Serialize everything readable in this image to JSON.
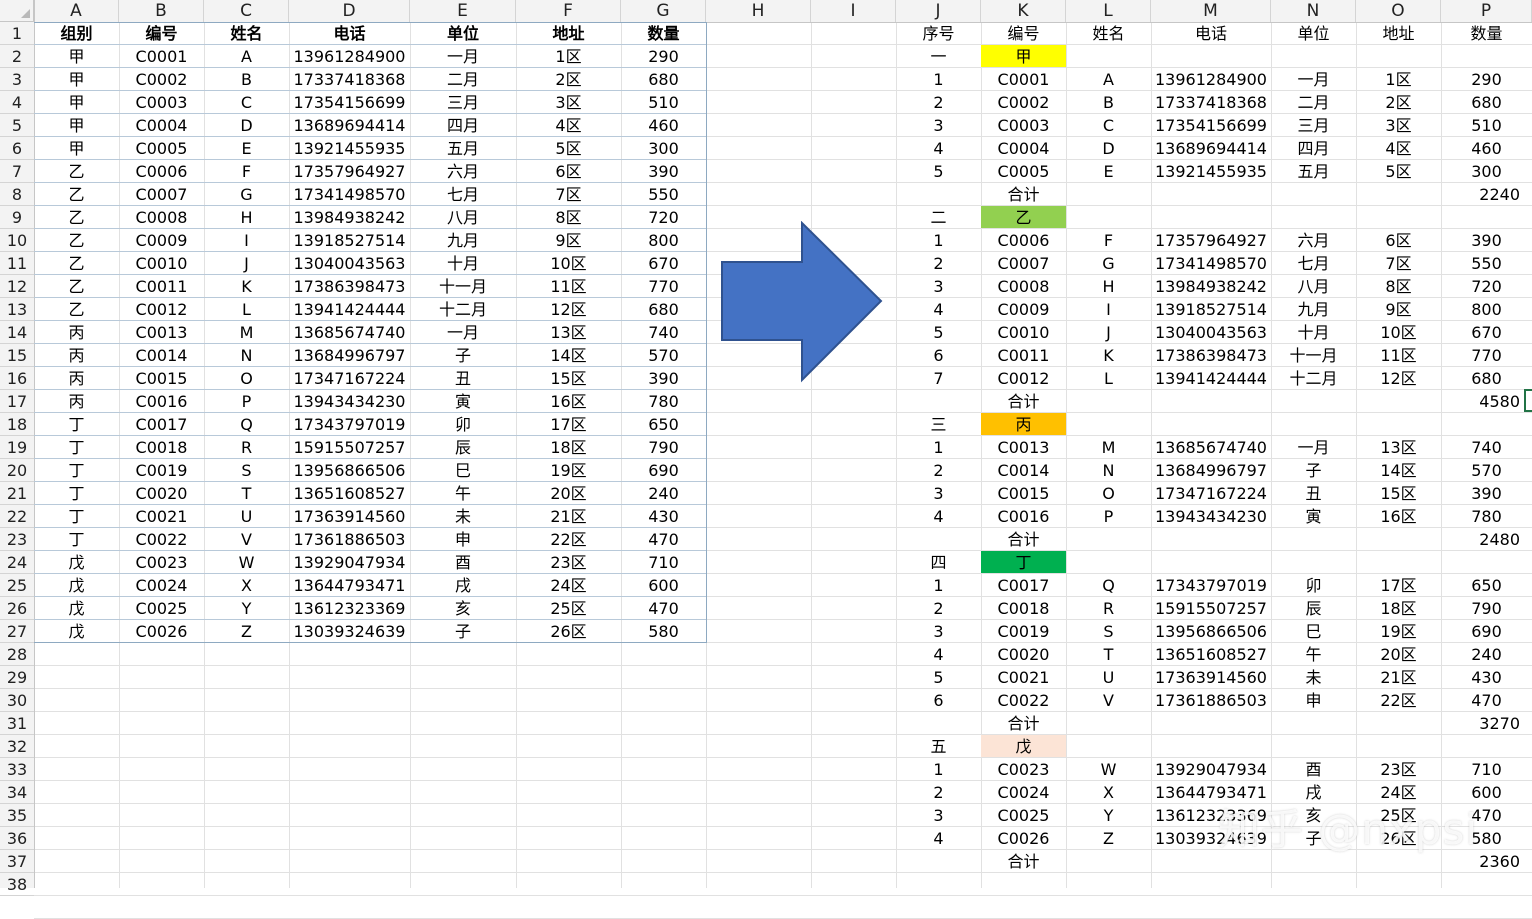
{
  "columns": [
    "A",
    "B",
    "C",
    "D",
    "E",
    "F",
    "G",
    "H",
    "I",
    "J",
    "K",
    "L",
    "M",
    "N",
    "O",
    "P"
  ],
  "rows": [
    "1",
    "2",
    "3",
    "4",
    "5",
    "6",
    "7",
    "8",
    "9",
    "10",
    "11",
    "12",
    "13",
    "14",
    "15",
    "16",
    "17",
    "18",
    "19",
    "20",
    "21",
    "22",
    "23",
    "24",
    "25",
    "26",
    "27",
    "28",
    "29",
    "30",
    "31",
    "32",
    "33",
    "34",
    "35",
    "36",
    "37",
    "38"
  ],
  "colors": {
    "group1": "#ffff00",
    "group2": "#92d050",
    "group3": "#ffc000",
    "group4": "#00b050",
    "group5": "#fce4d6",
    "arrow": "#4472c4",
    "grid": "#e1e1e1"
  },
  "source": {
    "headers": [
      "组别",
      "编号",
      "姓名",
      "电话",
      "单位",
      "地址",
      "数量"
    ],
    "rows": [
      [
        "甲",
        "C0001",
        "A",
        "13961284900",
        "一月",
        "1区",
        "290"
      ],
      [
        "甲",
        "C0002",
        "B",
        "17337418368",
        "二月",
        "2区",
        "680"
      ],
      [
        "甲",
        "C0003",
        "C",
        "17354156699",
        "三月",
        "3区",
        "510"
      ],
      [
        "甲",
        "C0004",
        "D",
        "13689694414",
        "四月",
        "4区",
        "460"
      ],
      [
        "甲",
        "C0005",
        "E",
        "13921455935",
        "五月",
        "5区",
        "300"
      ],
      [
        "乙",
        "C0006",
        "F",
        "17357964927",
        "六月",
        "6区",
        "390"
      ],
      [
        "乙",
        "C0007",
        "G",
        "17341498570",
        "七月",
        "7区",
        "550"
      ],
      [
        "乙",
        "C0008",
        "H",
        "13984938242",
        "八月",
        "8区",
        "720"
      ],
      [
        "乙",
        "C0009",
        "I",
        "13918527514",
        "九月",
        "9区",
        "800"
      ],
      [
        "乙",
        "C0010",
        "J",
        "13040043563",
        "十月",
        "10区",
        "670"
      ],
      [
        "乙",
        "C0011",
        "K",
        "17386398473",
        "十一月",
        "11区",
        "770"
      ],
      [
        "乙",
        "C0012",
        "L",
        "13941424444",
        "十二月",
        "12区",
        "680"
      ],
      [
        "丙",
        "C0013",
        "M",
        "13685674740",
        "一月",
        "13区",
        "740"
      ],
      [
        "丙",
        "C0014",
        "N",
        "13684996797",
        "子",
        "14区",
        "570"
      ],
      [
        "丙",
        "C0015",
        "O",
        "17347167224",
        "丑",
        "15区",
        "390"
      ],
      [
        "丙",
        "C0016",
        "P",
        "13943434230",
        "寅",
        "16区",
        "780"
      ],
      [
        "丁",
        "C0017",
        "Q",
        "17343797019",
        "卯",
        "17区",
        "650"
      ],
      [
        "丁",
        "C0018",
        "R",
        "15915507257",
        "辰",
        "18区",
        "790"
      ],
      [
        "丁",
        "C0019",
        "S",
        "13956866506",
        "巳",
        "19区",
        "690"
      ],
      [
        "丁",
        "C0020",
        "T",
        "13651608527",
        "午",
        "20区",
        "240"
      ],
      [
        "丁",
        "C0021",
        "U",
        "17363914560",
        "未",
        "21区",
        "430"
      ],
      [
        "丁",
        "C0022",
        "V",
        "17361886503",
        "申",
        "22区",
        "470"
      ],
      [
        "戊",
        "C0023",
        "W",
        "13929047934",
        "酉",
        "23区",
        "710"
      ],
      [
        "戊",
        "C0024",
        "X",
        "13644793471",
        "戌",
        "24区",
        "600"
      ],
      [
        "戊",
        "C0025",
        "Y",
        "13612323369",
        "亥",
        "25区",
        "470"
      ],
      [
        "戊",
        "C0026",
        "Z",
        "13039324639",
        "子",
        "26区",
        "580"
      ]
    ]
  },
  "result": {
    "headers": [
      "序号",
      "编号",
      "姓名",
      "电话",
      "单位",
      "地址",
      "数量"
    ],
    "total_label": "合计",
    "groups": [
      {
        "index": "一",
        "name": "甲",
        "color_key": "group1",
        "total": "2240",
        "items": [
          [
            "1",
            "C0001",
            "A",
            "13961284900",
            "一月",
            "1区",
            "290"
          ],
          [
            "2",
            "C0002",
            "B",
            "17337418368",
            "二月",
            "2区",
            "680"
          ],
          [
            "3",
            "C0003",
            "C",
            "17354156699",
            "三月",
            "3区",
            "510"
          ],
          [
            "4",
            "C0004",
            "D",
            "13689694414",
            "四月",
            "4区",
            "460"
          ],
          [
            "5",
            "C0005",
            "E",
            "13921455935",
            "五月",
            "5区",
            "300"
          ]
        ]
      },
      {
        "index": "二",
        "name": "乙",
        "color_key": "group2",
        "total": "4580",
        "items": [
          [
            "1",
            "C0006",
            "F",
            "17357964927",
            "六月",
            "6区",
            "390"
          ],
          [
            "2",
            "C0007",
            "G",
            "17341498570",
            "七月",
            "7区",
            "550"
          ],
          [
            "3",
            "C0008",
            "H",
            "13984938242",
            "八月",
            "8区",
            "720"
          ],
          [
            "4",
            "C0009",
            "I",
            "13918527514",
            "九月",
            "9区",
            "800"
          ],
          [
            "5",
            "C0010",
            "J",
            "13040043563",
            "十月",
            "10区",
            "670"
          ],
          [
            "6",
            "C0011",
            "K",
            "17386398473",
            "十一月",
            "11区",
            "770"
          ],
          [
            "7",
            "C0012",
            "L",
            "13941424444",
            "十二月",
            "12区",
            "680"
          ]
        ]
      },
      {
        "index": "三",
        "name": "丙",
        "color_key": "group3",
        "total": "2480",
        "items": [
          [
            "1",
            "C0013",
            "M",
            "13685674740",
            "一月",
            "13区",
            "740"
          ],
          [
            "2",
            "C0014",
            "N",
            "13684996797",
            "子",
            "14区",
            "570"
          ],
          [
            "3",
            "C0015",
            "O",
            "17347167224",
            "丑",
            "15区",
            "390"
          ],
          [
            "4",
            "C0016",
            "P",
            "13943434230",
            "寅",
            "16区",
            "780"
          ]
        ]
      },
      {
        "index": "四",
        "name": "丁",
        "color_key": "group4",
        "total": "3270",
        "items": [
          [
            "1",
            "C0017",
            "Q",
            "17343797019",
            "卯",
            "17区",
            "650"
          ],
          [
            "2",
            "C0018",
            "R",
            "15915507257",
            "辰",
            "18区",
            "790"
          ],
          [
            "3",
            "C0019",
            "S",
            "13956866506",
            "巳",
            "19区",
            "690"
          ],
          [
            "4",
            "C0020",
            "T",
            "13651608527",
            "午",
            "20区",
            "240"
          ],
          [
            "5",
            "C0021",
            "U",
            "17363914560",
            "未",
            "21区",
            "430"
          ],
          [
            "6",
            "C0022",
            "V",
            "17361886503",
            "申",
            "22区",
            "470"
          ]
        ]
      },
      {
        "index": "五",
        "name": "戊",
        "color_key": "group5",
        "total": "2360",
        "items": [
          [
            "1",
            "C0023",
            "W",
            "13929047934",
            "酉",
            "23区",
            "710"
          ],
          [
            "2",
            "C0024",
            "X",
            "13644793471",
            "戌",
            "24区",
            "600"
          ],
          [
            "3",
            "C0025",
            "Y",
            "13612323369",
            "亥",
            "25区",
            "470"
          ],
          [
            "4",
            "C0026",
            "Z",
            "13039324639",
            "子",
            "26区",
            "580"
          ]
        ]
      }
    ]
  },
  "watermark": "知乎 @nxpsi"
}
